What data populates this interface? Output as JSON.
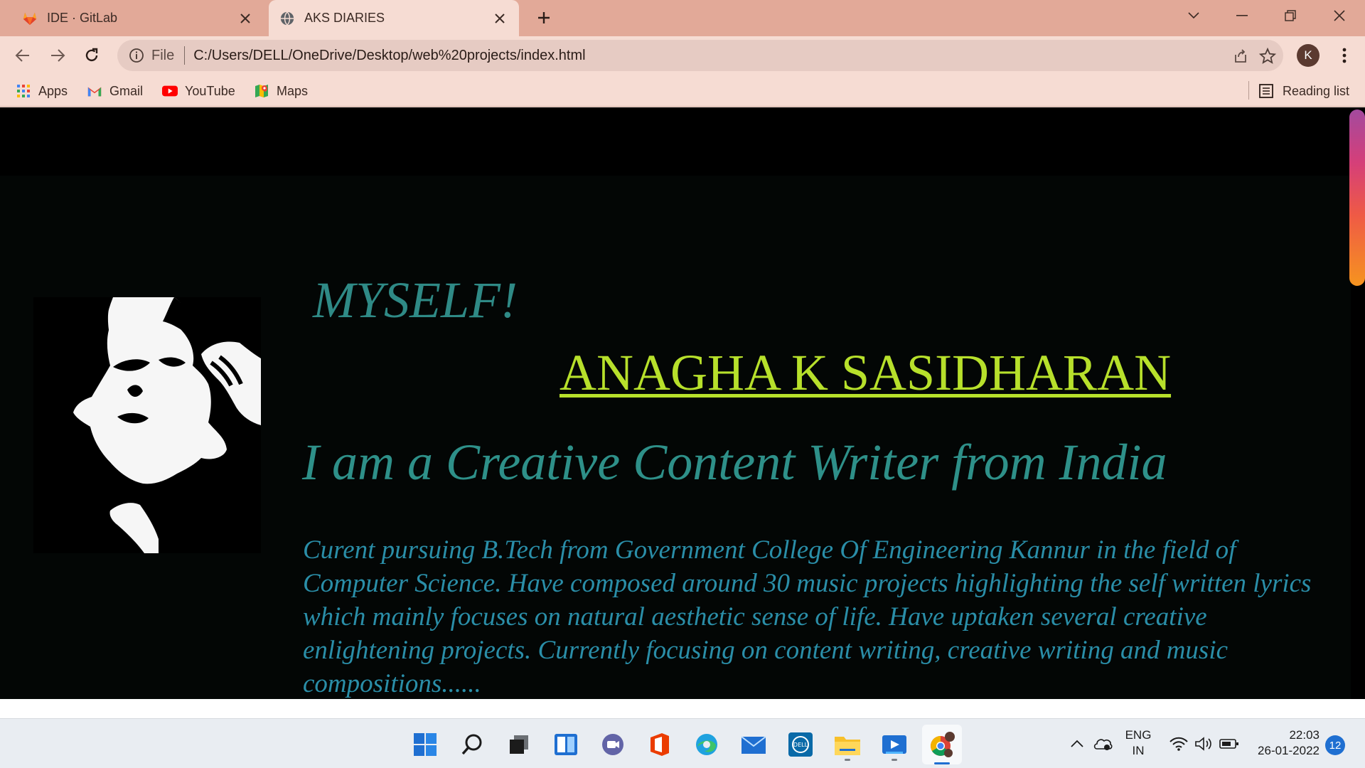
{
  "browser": {
    "tabs": [
      {
        "title": "IDE · GitLab",
        "icon": "gitlab-icon",
        "active": false
      },
      {
        "title": "AKS DIARIES",
        "icon": "globe-icon",
        "active": true
      }
    ],
    "address": {
      "scheme_label": "File",
      "url": "C:/Users/DELL/OneDrive/Desktop/web%20projects/index.html"
    },
    "profile_initial": "K",
    "bookmarks": [
      {
        "label": "Apps",
        "icon": "apps-grid-icon"
      },
      {
        "label": "Gmail",
        "icon": "gmail-icon"
      },
      {
        "label": "YouTube",
        "icon": "youtube-icon"
      },
      {
        "label": "Maps",
        "icon": "maps-icon"
      }
    ],
    "reading_list": "Reading list"
  },
  "page": {
    "heading": "MYSELF!",
    "name": "ANAGHA K SASIDHARAN",
    "tagline": "I am a Creative Content Writer from India",
    "bio": "Curent pursuing B.Tech from Government College Of Engineering Kannur in the field of Computer Science. Have composed around 30 music projects highlighting the self written lyrics which mainly focuses on natural aesthetic sense of life. Have uptaken several creative enlightening projects. Currently focusing on content writing, creative writing and music compositions......",
    "colors": {
      "heading": "#2f8a86",
      "name": "#b7e02b",
      "tagline": "#2e9089",
      "bio": "#2a8ea8",
      "background": "#000000"
    }
  },
  "taskbar": {
    "apps": [
      "start-icon",
      "search-icon",
      "task-view-icon",
      "widgets-icon",
      "teams-chat-icon",
      "office-icon",
      "edge-icon",
      "mail-icon",
      "dell-icon",
      "file-explorer-icon",
      "media-player-icon",
      "chrome-icon"
    ],
    "language": {
      "line1": "ENG",
      "line2": "IN"
    },
    "time": "22:03",
    "date": "26-01-2022",
    "notification_count": "12"
  }
}
